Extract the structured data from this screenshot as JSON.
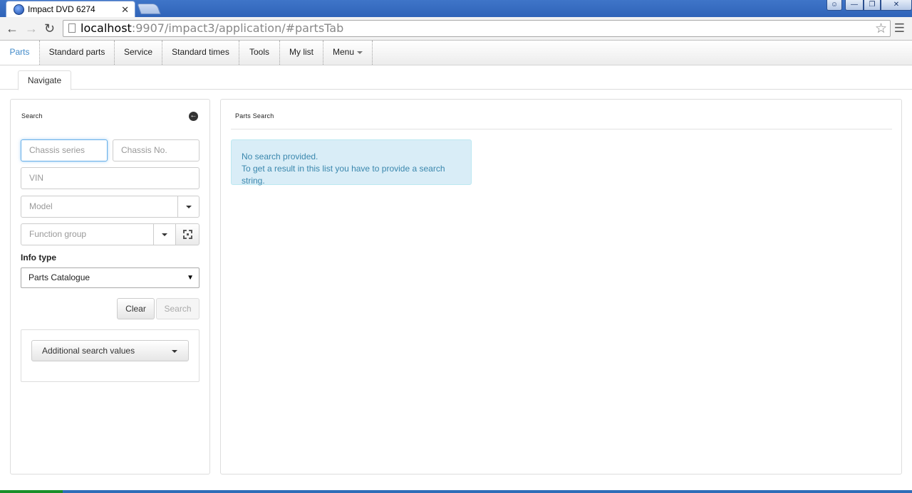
{
  "browser": {
    "tab_title": "Impact DVD 6274",
    "url_host": "localhost",
    "url_path": ":9907/impact3/application/#partsTab",
    "window_controls": [
      "user-icon",
      "minimize-icon",
      "restore-icon",
      "close-icon"
    ]
  },
  "app_nav": {
    "items": [
      "Parts",
      "Standard parts",
      "Service",
      "Standard times",
      "Tools",
      "My list",
      "Menu"
    ],
    "active": "Parts"
  },
  "subtabs": {
    "navigate": "Navigate"
  },
  "search_panel": {
    "title": "Search",
    "chassis_series_placeholder": "Chassis series",
    "chassis_no_placeholder": "Chassis No.",
    "vin_placeholder": "VIN",
    "model_placeholder": "Model",
    "function_group_placeholder": "Function group",
    "info_type_label": "Info type",
    "info_type_value": "Parts Catalogue",
    "clear_label": "Clear",
    "search_label": "Search",
    "additional_values_label": "Additional search values"
  },
  "results_panel": {
    "title": "Parts Search",
    "alert_line1": "No search provided.",
    "alert_line2": "To get a result in this list you have to provide a search string."
  },
  "colors": {
    "accent": "#428bca",
    "alert_bg": "#d9edf7",
    "alert_text": "#3a87ad",
    "titlebar": "#3f75c8"
  }
}
